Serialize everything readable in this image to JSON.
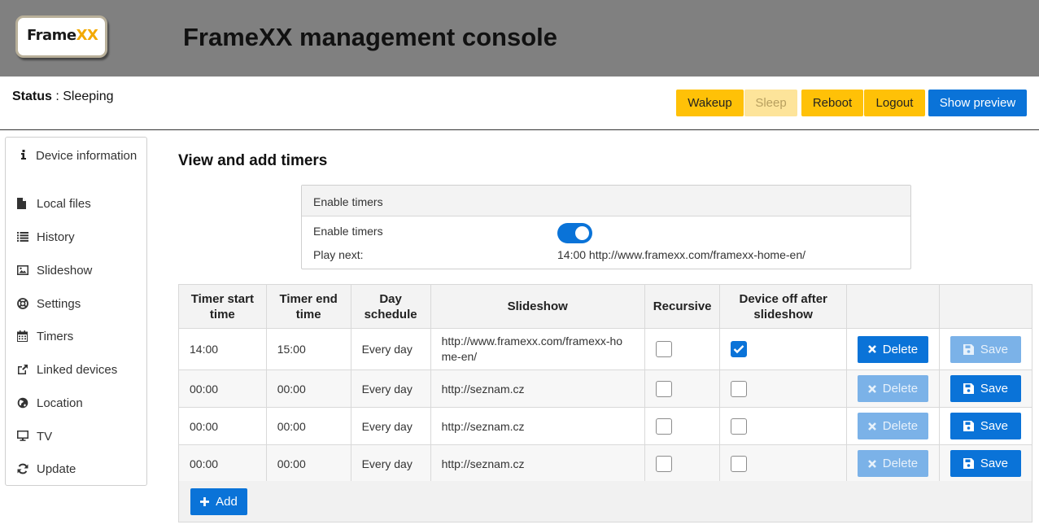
{
  "header": {
    "logo_text_a": "Frame",
    "logo_text_b": "XX",
    "title": "FrameXX management console"
  },
  "status": {
    "label": "Status",
    "separator": " : ",
    "value": "Sleeping"
  },
  "actions": {
    "wakeup": "Wakeup",
    "sleep": "Sleep",
    "reboot": "Reboot",
    "logout": "Logout",
    "preview": "Show preview"
  },
  "sidebar": {
    "items": [
      {
        "label": "Device information",
        "icon": "info-icon"
      },
      {
        "label": "Local files",
        "icon": "file-icon"
      },
      {
        "label": "History",
        "icon": "list-icon"
      },
      {
        "label": "Slideshow",
        "icon": "image-icon"
      },
      {
        "label": "Settings",
        "icon": "lifebuoy-icon"
      },
      {
        "label": "Timers",
        "icon": "calendar-icon"
      },
      {
        "label": "Linked devices",
        "icon": "external-link-icon"
      },
      {
        "label": "Location",
        "icon": "globe-icon"
      },
      {
        "label": "TV",
        "icon": "monitor-icon"
      },
      {
        "label": "Update",
        "icon": "refresh-icon"
      }
    ]
  },
  "main": {
    "title": "View and add timers",
    "panel": {
      "heading": "Enable timers",
      "enable_label": "Enable timers",
      "enabled": true,
      "play_next_label": "Play next:",
      "play_next_value": "14:00 http://www.framexx.com/framexx-home-en/"
    },
    "table": {
      "columns": [
        "Timer start time",
        "Timer end time",
        "Day schedule",
        "Slideshow",
        "Recursive",
        "Device off after slideshow",
        "",
        ""
      ],
      "rows": [
        {
          "start": "14:00",
          "end": "15:00",
          "schedule": "Every day",
          "slideshow": "http://www.framexx.com/framexx-home-en/",
          "recursive": false,
          "device_off": true,
          "delete_enabled": true,
          "save_enabled": false
        },
        {
          "start": "00:00",
          "end": "00:00",
          "schedule": "Every day",
          "slideshow": "http://seznam.cz",
          "recursive": false,
          "device_off": false,
          "delete_enabled": false,
          "save_enabled": true
        },
        {
          "start": "00:00",
          "end": "00:00",
          "schedule": "Every day",
          "slideshow": "http://seznam.cz",
          "recursive": false,
          "device_off": false,
          "delete_enabled": false,
          "save_enabled": true
        },
        {
          "start": "00:00",
          "end": "00:00",
          "schedule": "Every day",
          "slideshow": "http://seznam.cz",
          "recursive": false,
          "device_off": false,
          "delete_enabled": false,
          "save_enabled": true
        }
      ],
      "delete_label": "Delete",
      "save_label": "Save"
    },
    "add_label": "Add"
  },
  "colors": {
    "header_bg": "#808080",
    "amber": "#ffc107",
    "primary": "#0a73d8"
  }
}
